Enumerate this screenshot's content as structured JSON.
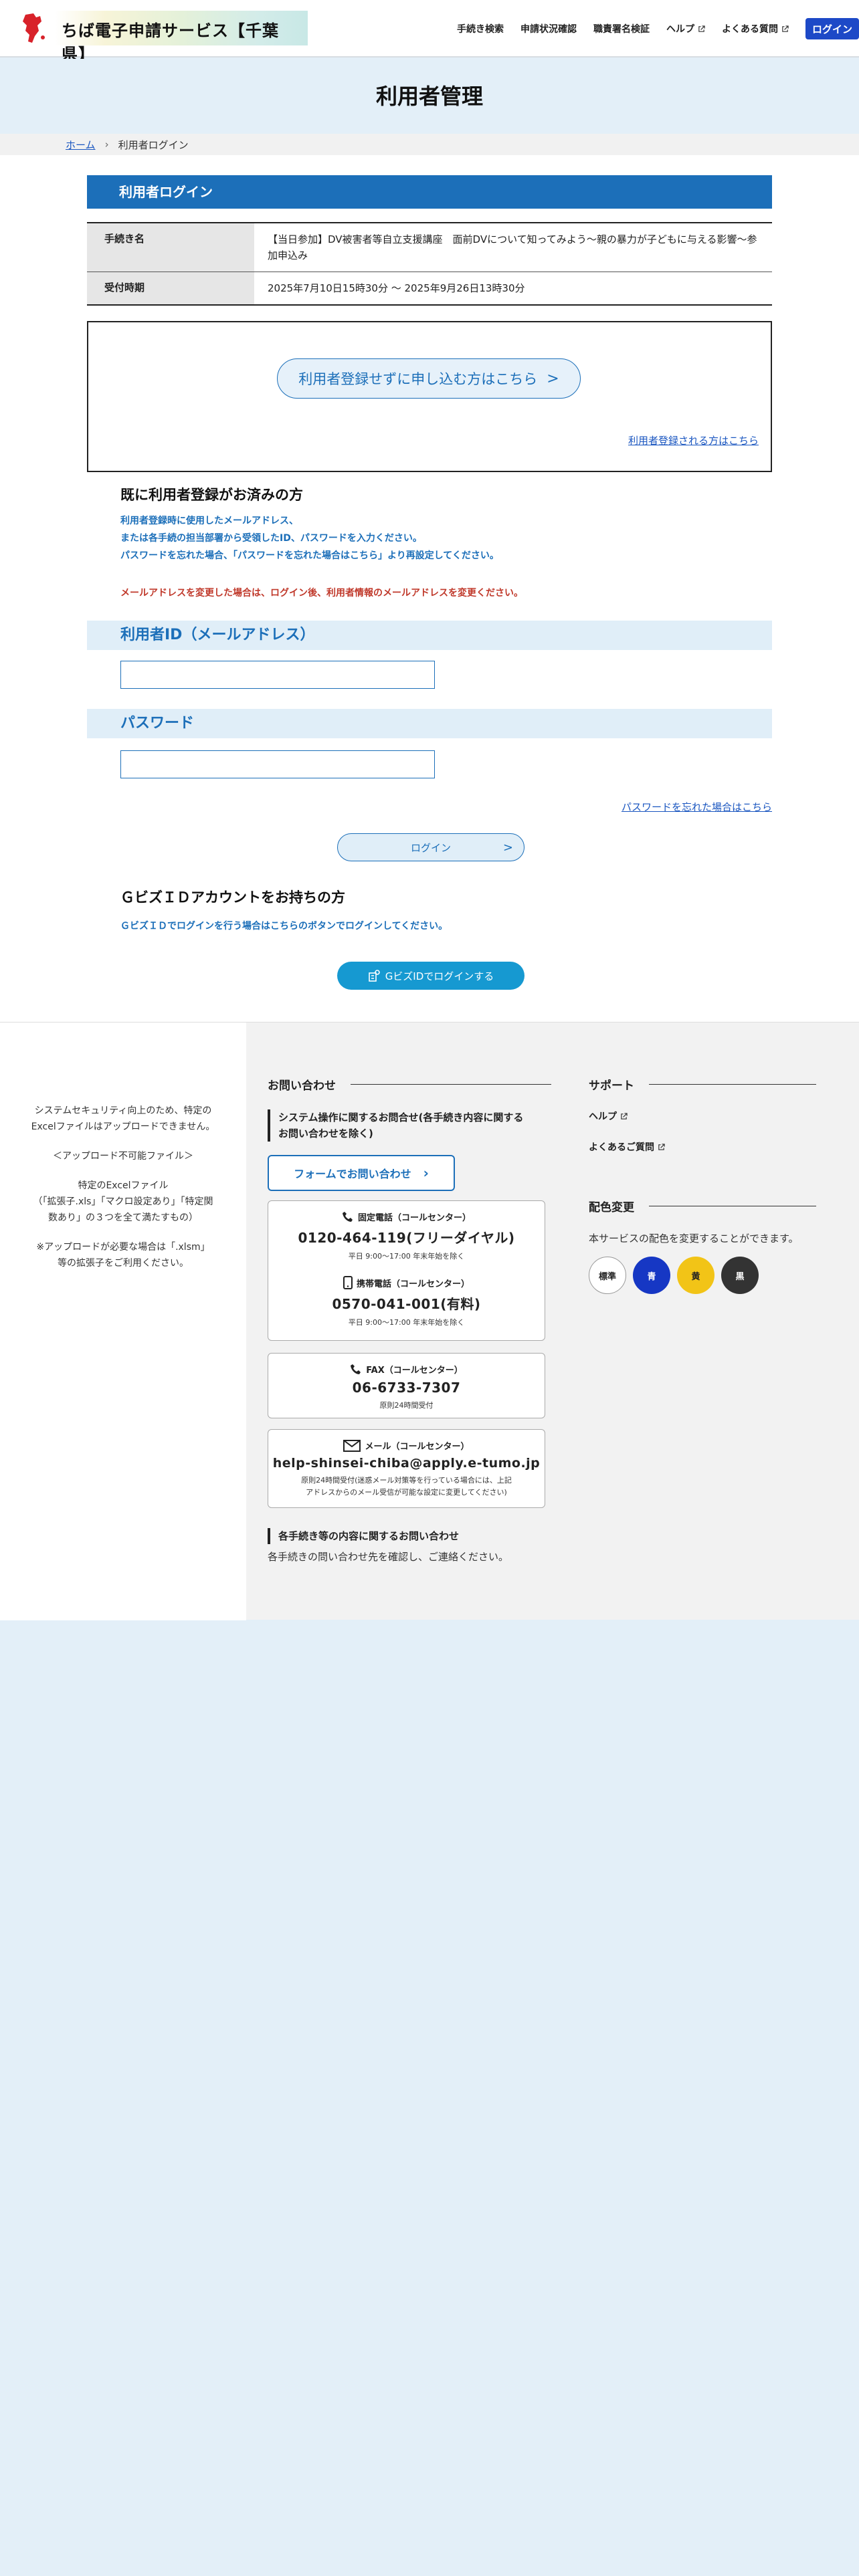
{
  "header": {
    "site_title": "ちば電子申請サービス【千葉県】",
    "nav": [
      {
        "label": "手続き検索",
        "external": false
      },
      {
        "label": "申請状況確認",
        "external": false
      },
      {
        "label": "職責署名検証",
        "external": false
      },
      {
        "label": "ヘルプ",
        "external": true
      },
      {
        "label": "よくある質問",
        "external": true
      }
    ],
    "login_label": "ログイン"
  },
  "page_title": "利用者管理",
  "breadcrumb": {
    "home": "ホーム",
    "current": "利用者ログイン"
  },
  "login_section": {
    "heading": "利用者ログイン",
    "procedure_label": "手続き名",
    "procedure_value": "【当日参加】DV被害者等自立支援講座　面前DVについて知ってみよう～親の暴力が子どもに与える影響～参加申込み",
    "period_label": "受付時期",
    "period_value": "2025年7月10日15時30分 ～ 2025年9月26日13時30分"
  },
  "guest": {
    "button_label": "利用者登録せずに申し込む方はこちら",
    "register_link": "利用者登録される方はこちら"
  },
  "registered": {
    "heading": "既に利用者登録がお済みの方",
    "notes": [
      "利用者登録時に使用したメールアドレス、",
      "または各手続の担当部署から受領したID、パスワードを入力ください。",
      "パスワードを忘れた場合、「パスワードを忘れた場合はこちら」より再設定してください。"
    ],
    "warning": "メールアドレスを変更した場合は、ログイン後、利用者情報のメールアドレスを変更ください。",
    "id_label": "利用者ID（メールアドレス）",
    "id_value": "",
    "password_label": "パスワード",
    "password_value": "",
    "forgot_link": "パスワードを忘れた場合はこちら",
    "login_button": "ログイン"
  },
  "gbiz": {
    "heading": "ＧビズＩＤアカウントをお持ちの方",
    "note": "ＧビズＩＤでログインを行う場合はこちらのボタンでログインしてください。",
    "button_label": "GビズIDでログインする"
  },
  "footer": {
    "left_notes": [
      "システムセキュリティ向上のため、特定の",
      "Excelファイルはアップロードできません。",
      "＜アップロード不可能ファイル＞",
      "特定のExcelファイル",
      "（「拡張子.xls」「マクロ設定あり」「特定関",
      "数あり」の３つを全て満たすもの）",
      "※アップロードが必要な場合は「.xlsm」",
      "等の拡張子をご利用ください。"
    ],
    "contact": {
      "title": "お問い合わせ",
      "system_heading_1": "システム操作に関するお問合せ(各手続き内容に関する",
      "system_heading_2": "お問い合わせを除く)",
      "form_button": "フォームでお問い合わせ",
      "landline_label": "固定電話（コールセンター）",
      "landline_number": "0120-464-119(フリーダイヤル)",
      "landline_hours": "平日 9:00～17:00 年末年始を除く",
      "mobile_label": "携帯電話（コールセンター）",
      "mobile_number": "0570-041-001(有料)",
      "mobile_hours": "平日 9:00～17:00 年末年始を除く",
      "fax_label": "FAX（コールセンター）",
      "fax_number": "06-6733-7307",
      "fax_hours": "原則24時間受付",
      "mail_label": "メール（コールセンター）",
      "mail_address": "help-shinsei-chiba@apply.e-tumo.jp",
      "mail_note_1": "原則24時間受付(迷惑メール対策等を行っている場合には、上記",
      "mail_note_2": "アドレスからのメール受信が可能な設定に変更してください)",
      "procedure_heading": "各手続き等の内容に関するお問い合わせ",
      "procedure_text": "各手続きの問い合わせ先を確認し、ご連絡ください。"
    },
    "support": {
      "title": "サポート",
      "links": [
        "ヘルプ",
        "よくあるご質問"
      ]
    },
    "color_change": {
      "title": "配色変更",
      "description": "本サービスの配色を変更することができます。",
      "options": [
        {
          "label": "標準",
          "bg": "#ffffff",
          "fg": "#222222"
        },
        {
          "label": "青",
          "bg": "#1637c4",
          "fg": "#ffffff"
        },
        {
          "label": "黄",
          "bg": "#f2c417",
          "fg": "#222222"
        },
        {
          "label": "黒",
          "bg": "#333333",
          "fg": "#ffffff"
        }
      ]
    }
  }
}
